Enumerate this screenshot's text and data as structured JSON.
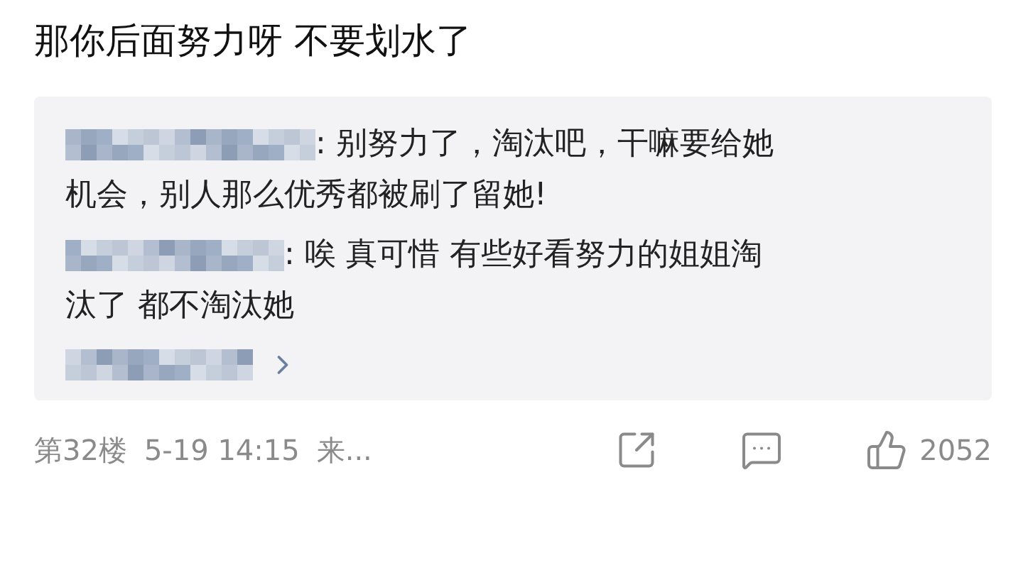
{
  "comment": {
    "text": "那你后面努力呀 不要划水了"
  },
  "replies": [
    {
      "lines": [
        ": 别努力了，淘汰吧，干嘛要给她",
        "机会，别人那么优秀都被刷了留她!"
      ]
    },
    {
      "lines": [
        ": 唉 真可惜 有些好看努力的姐姐淘",
        "汰了 都不淘汰她"
      ]
    }
  ],
  "footer": {
    "floor": "第32楼",
    "time": "5-19 14:15",
    "source": "来...",
    "likes": "2052"
  }
}
